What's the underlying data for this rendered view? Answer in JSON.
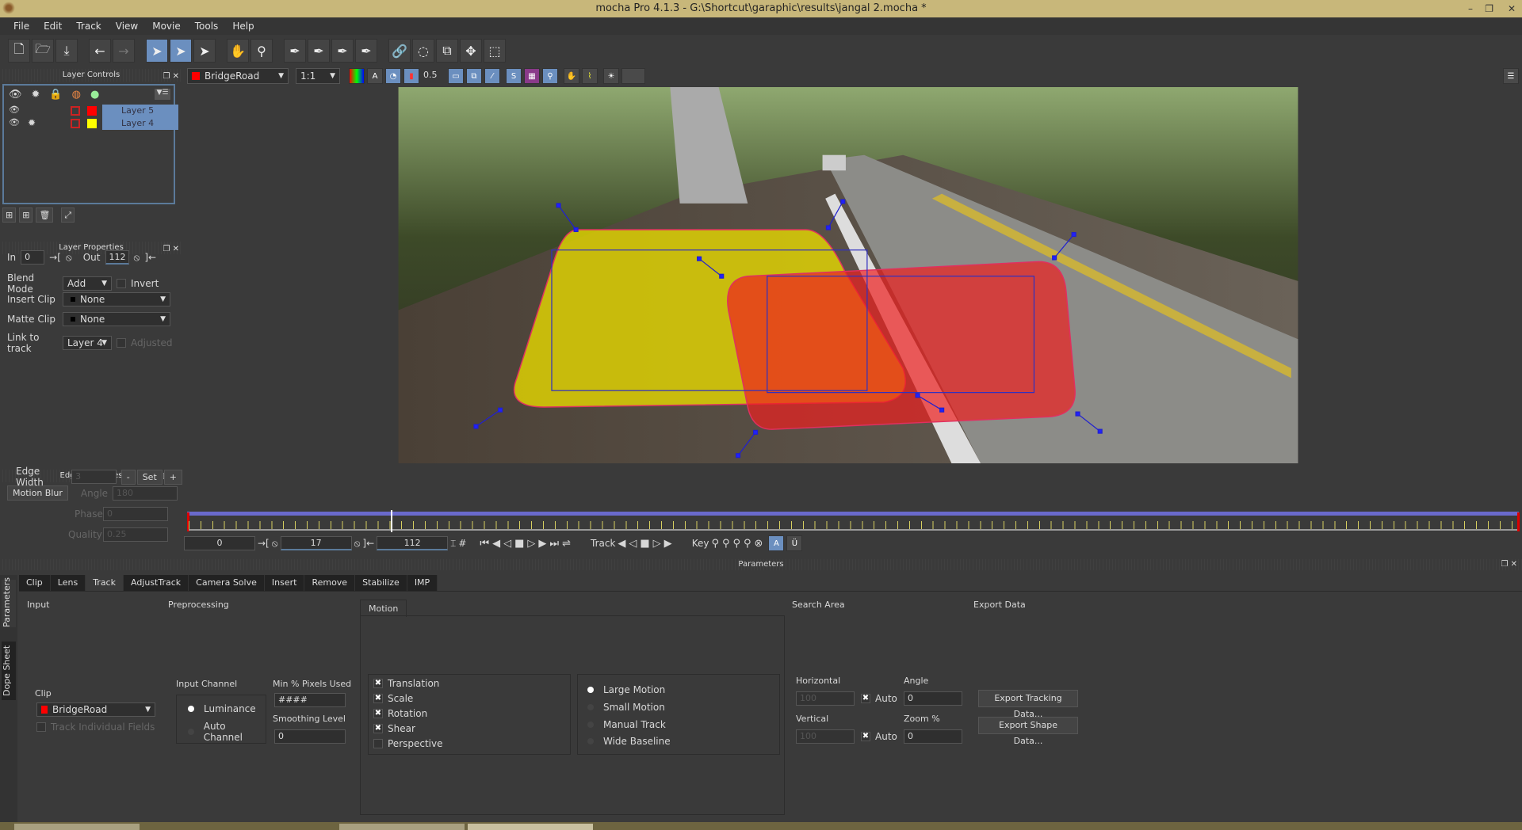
{
  "window": {
    "title": "mocha Pro 4.1.3 - G:\\Shortcut\\garaphic\\results\\jangal 2.mocha *",
    "controls": [
      "–",
      "❐",
      "✕"
    ]
  },
  "menu": [
    "File",
    "Edit",
    "Track",
    "View",
    "Movie",
    "Tools",
    "Help"
  ],
  "viewer_toolbar": {
    "clip": "BridgeRoad",
    "clip_color": "#ff0000",
    "zoom": "1:1",
    "opacity": "0.5"
  },
  "layer_controls": {
    "title": "Layer Controls",
    "layers": [
      {
        "name": "Layer 5",
        "color": "#ff0000"
      },
      {
        "name": "Layer 4",
        "color": "#ffff00"
      }
    ]
  },
  "layer_properties": {
    "title": "Layer Properties",
    "in_label": "In",
    "in": "0",
    "out_label": "Out",
    "out": "112",
    "blend_label": "Blend Mode",
    "blend": "Add",
    "invert": "Invert",
    "insert_label": "Insert Clip",
    "insert": "None",
    "matte_label": "Matte Clip",
    "matte": "None",
    "link_label": "Link to track",
    "link": "Layer 4",
    "adjusted": "Adjusted"
  },
  "edge_properties": {
    "title": "Edge Properties",
    "edge_width_label": "Edge Width",
    "edge_width": "3",
    "minus": "-",
    "set": "Set",
    "plus": "+",
    "motion_blur": "Motion Blur",
    "angle_label": "Angle",
    "angle": "180",
    "phase_label": "Phase",
    "phase": "0",
    "quality_label": "Quality",
    "quality": "0.25"
  },
  "timeline": {
    "start": "0",
    "current": "17",
    "end": "112",
    "track_label": "Track",
    "key_label": "Key",
    "current_fraction": 0.152
  },
  "parameters": {
    "title": "Parameters",
    "side_tabs": [
      "Parameters",
      "Dope Sheet"
    ],
    "tabs": [
      "Clip",
      "Lens",
      "Track",
      "AdjustTrack",
      "Camera Solve",
      "Insert",
      "Remove",
      "Stabilize",
      "IMP"
    ],
    "active_tab": "Track",
    "input": {
      "title": "Input",
      "clip_label": "Clip",
      "clip": "BridgeRoad",
      "track_fields": "Track Individual Fields"
    },
    "preprocessing": {
      "title": "Preprocessing",
      "channel_label": "Input Channel",
      "channels": [
        "Luminance",
        "Auto Channel"
      ],
      "min_pixels_label": "Min % Pixels Used",
      "min_pixels": "####",
      "smoothing_label": "Smoothing Level",
      "smoothing": "0"
    },
    "motion": {
      "title": "Motion",
      "checks": [
        {
          "label": "Translation",
          "on": true
        },
        {
          "label": "Scale",
          "on": true
        },
        {
          "label": "Rotation",
          "on": true
        },
        {
          "label": "Shear",
          "on": true
        },
        {
          "label": "Perspective",
          "on": false
        }
      ],
      "modes": [
        "Large Motion",
        "Small Motion",
        "Manual Track",
        "Wide Baseline"
      ],
      "selected_mode": "Large Motion"
    },
    "search_area": {
      "title": "Search Area",
      "horizontal_label": "Horizontal",
      "horizontal": "100",
      "vertical_label": "Vertical",
      "vertical": "100",
      "auto": "Auto",
      "angle_label": "Angle",
      "angle": "0",
      "zoom_label": "Zoom %",
      "zoom": "0"
    },
    "export": {
      "title": "Export Data",
      "tracking": "Export Tracking Data...",
      "shape": "Export Shape Data..."
    }
  }
}
